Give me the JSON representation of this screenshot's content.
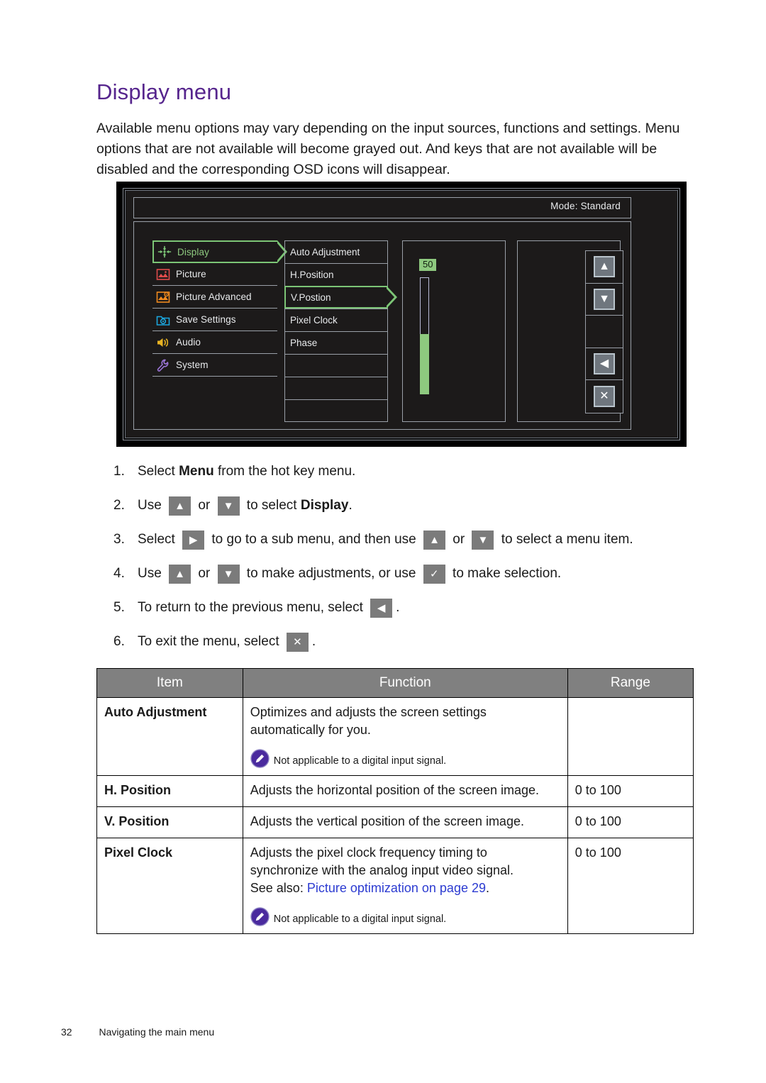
{
  "page": {
    "title": "Display menu",
    "intro": "Available menu options may vary depending on the input sources, functions and settings. Menu options that are not available will become grayed out. And keys that are not available will be disabled and the corresponding OSD icons will disappear.",
    "footer_page_number": "32",
    "footer_text": "Navigating the main menu",
    "title_color": "#56258d",
    "link_color": "#2c3bd1"
  },
  "osd": {
    "mode_label": "Mode: Standard",
    "categories": [
      {
        "label": "Display",
        "icon": "display-icon",
        "color": "#7cc576",
        "selected": true
      },
      {
        "label": "Picture",
        "icon": "picture-icon",
        "color": "#e04b4b",
        "selected": false
      },
      {
        "label": "Picture Advanced",
        "icon": "picture-advanced-icon",
        "color": "#f08a1e",
        "selected": false
      },
      {
        "label": "Save Settings",
        "icon": "save-settings-icon",
        "color": "#1ba6dd",
        "selected": false
      },
      {
        "label": "Audio",
        "icon": "audio-icon",
        "color": "#e8b323",
        "selected": false
      },
      {
        "label": "System",
        "icon": "system-icon",
        "color": "#9b74d6",
        "selected": false
      }
    ],
    "submenu": [
      {
        "label": "Auto Adjustment",
        "selected": false
      },
      {
        "label": "H.Position",
        "selected": false
      },
      {
        "label": "V.Postion",
        "selected": true
      },
      {
        "label": "Pixel Clock",
        "selected": false
      },
      {
        "label": "Phase",
        "selected": false
      },
      {
        "label": "",
        "selected": false
      },
      {
        "label": "",
        "selected": false
      },
      {
        "label": "",
        "selected": false
      }
    ],
    "slider": {
      "value": "50",
      "fill_percent": 52,
      "fill_color": "#8ec97f",
      "badge_bg": "#8ec97f"
    },
    "keys": [
      {
        "icon": "arrow-up-icon",
        "glyph": "▲"
      },
      {
        "icon": "arrow-down-icon",
        "glyph": "▼"
      },
      {
        "icon": "blank-key",
        "glyph": ""
      },
      {
        "icon": "arrow-left-icon",
        "glyph": "◀"
      },
      {
        "icon": "close-x-icon",
        "glyph": "✕"
      }
    ]
  },
  "steps": [
    {
      "num": "1.",
      "parts": [
        {
          "t": "text",
          "v": "Select "
        },
        {
          "t": "bold",
          "v": "Menu"
        },
        {
          "t": "text",
          "v": " from the hot key menu."
        }
      ]
    },
    {
      "num": "2.",
      "parts": [
        {
          "t": "text",
          "v": "Use "
        },
        {
          "t": "key",
          "icon": "arrow-up-icon",
          "glyph": "▲"
        },
        {
          "t": "text",
          "v": " or "
        },
        {
          "t": "key",
          "icon": "arrow-down-icon",
          "glyph": "▼"
        },
        {
          "t": "text",
          "v": " to select "
        },
        {
          "t": "bold",
          "v": "Display"
        },
        {
          "t": "text",
          "v": "."
        }
      ]
    },
    {
      "num": "3.",
      "parts": [
        {
          "t": "text",
          "v": "Select "
        },
        {
          "t": "key",
          "icon": "arrow-right-icon",
          "glyph": "▶"
        },
        {
          "t": "text",
          "v": " to go to a sub menu, and then use "
        },
        {
          "t": "key",
          "icon": "arrow-up-icon",
          "glyph": "▲"
        },
        {
          "t": "text",
          "v": " or "
        },
        {
          "t": "key",
          "icon": "arrow-down-icon",
          "glyph": "▼"
        },
        {
          "t": "text",
          "v": " to select a menu item."
        }
      ]
    },
    {
      "num": "4.",
      "parts": [
        {
          "t": "text",
          "v": "Use "
        },
        {
          "t": "key",
          "icon": "arrow-up-icon",
          "glyph": "▲"
        },
        {
          "t": "text",
          "v": " or "
        },
        {
          "t": "key",
          "icon": "arrow-down-icon",
          "glyph": "▼"
        },
        {
          "t": "text",
          "v": " to make adjustments, or use "
        },
        {
          "t": "key",
          "icon": "check-icon",
          "glyph": "✓"
        },
        {
          "t": "text",
          "v": " to make selection."
        }
      ]
    },
    {
      "num": "5.",
      "parts": [
        {
          "t": "text",
          "v": "To return to the previous menu, select "
        },
        {
          "t": "key",
          "icon": "arrow-left-icon",
          "glyph": "◀"
        },
        {
          "t": "text",
          "v": "."
        }
      ]
    },
    {
      "num": "6.",
      "parts": [
        {
          "t": "text",
          "v": "To exit the menu, select "
        },
        {
          "t": "key",
          "icon": "close-x-icon",
          "glyph": "✕"
        },
        {
          "t": "text",
          "v": "."
        }
      ]
    }
  ],
  "table": {
    "headers": [
      "Item",
      "Function",
      "Range"
    ],
    "rows": [
      {
        "item": "Auto Adjustment",
        "lines": [
          "Optimizes and adjusts the screen settings",
          "automatically for you."
        ],
        "see_also_prefix": "",
        "see_also_link": "",
        "see_also_suffix": "",
        "note": "Not applicable to a digital input signal.",
        "range": ""
      },
      {
        "item": "H. Position",
        "lines": [
          "Adjusts the horizontal position of the screen image."
        ],
        "see_also_prefix": "",
        "see_also_link": "",
        "see_also_suffix": "",
        "note": "",
        "range": "0 to 100"
      },
      {
        "item": "V. Position",
        "lines": [
          "Adjusts the vertical position of the screen image."
        ],
        "see_also_prefix": "",
        "see_also_link": "",
        "see_also_suffix": "",
        "note": "",
        "range": "0 to 100"
      },
      {
        "item": "Pixel Clock",
        "lines": [
          "Adjusts the pixel clock frequency timing to",
          "synchronize with the analog input video signal."
        ],
        "see_also_prefix": "See also: ",
        "see_also_link": "Picture optimization on page 29",
        "see_also_suffix": ".",
        "note": "Not applicable to a digital input signal.",
        "range": "0 to 100"
      }
    ]
  }
}
